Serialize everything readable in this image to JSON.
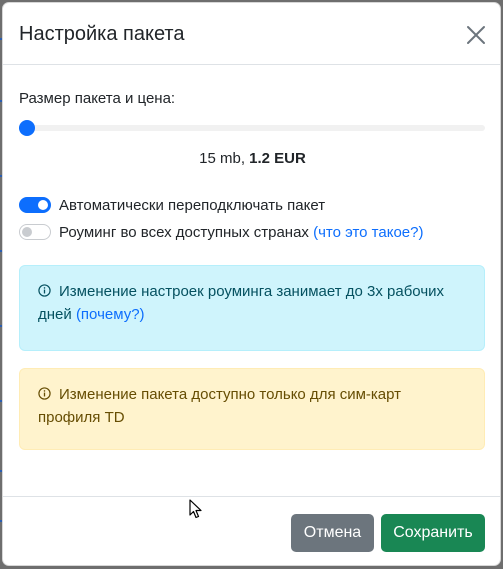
{
  "modal": {
    "title": "Настройка пакета",
    "close_icon": "close-icon"
  },
  "package": {
    "label": "Размер пакета и цена:",
    "slider_level": 0,
    "size": "15 mb, ",
    "price": "1.2 EUR"
  },
  "switches": {
    "auto_reconnect": {
      "label": "Автоматически переподключать пакет",
      "checked": true
    },
    "roaming": {
      "label": "Роуминг во всех доступных странах",
      "checked": false,
      "help_link": "(что это такое?)"
    }
  },
  "alerts": {
    "info": {
      "icon": "info-circle-icon",
      "text": "Изменение настроек роуминга занимает до 3х рабочих дней ",
      "link": "(почему?)"
    },
    "warning": {
      "icon": "info-circle-icon",
      "text": "Изменение пакета доступно только для сим-карт профиля TD"
    }
  },
  "footer": {
    "cancel_label": "Отмена",
    "save_label": "Сохранить"
  },
  "colors": {
    "primary": "#0d6efd",
    "secondary": "#6c757d",
    "success": "#198754",
    "info_bg": "#cff4fc",
    "warning_bg": "#fff3cd"
  }
}
